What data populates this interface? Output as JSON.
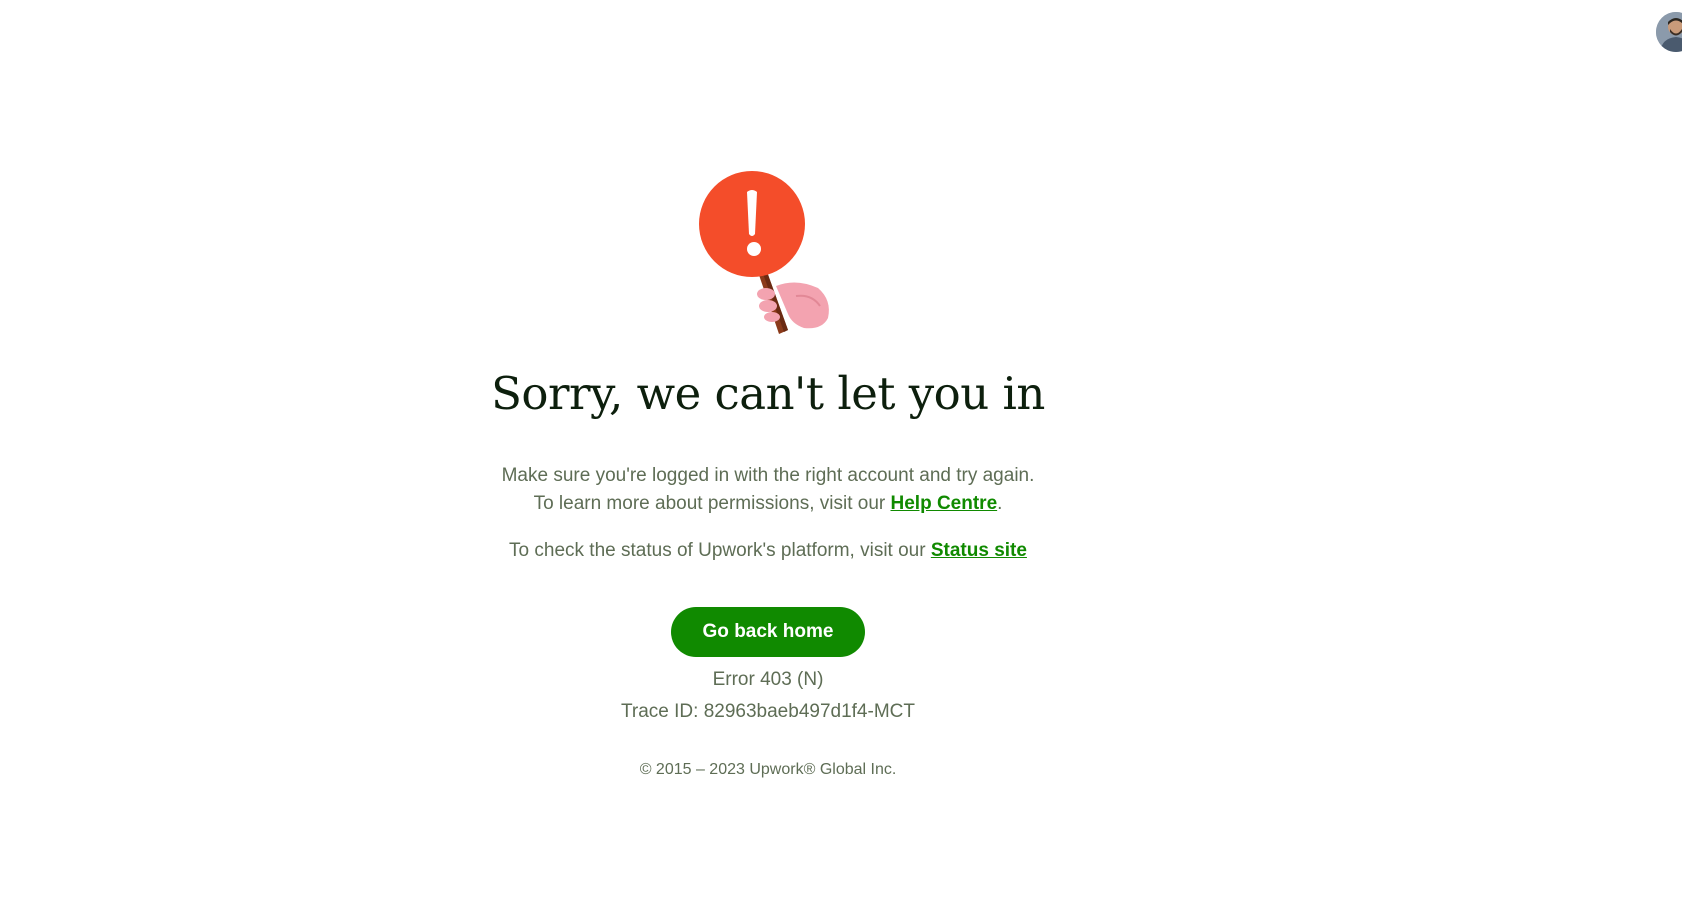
{
  "header": {
    "avatar_icon": "user-avatar-icon"
  },
  "illustration": {
    "icon": "stop-sign-hand-icon",
    "sign_color": "#f44d2a",
    "handle_color": "#8b3a1a",
    "hand_color": "#f3a3b0"
  },
  "main": {
    "title": "Sorry, we can't let you in",
    "message_line1": "Make sure you're logged in with the right account and try again.",
    "message_line2_prefix": "To learn more about permissions, visit our ",
    "help_link_label": "Help Centre",
    "message_line2_suffix": ".",
    "status_prefix": "To check the status of Upwork's platform, visit our ",
    "status_link_label": "Status site",
    "home_button_label": "Go back home",
    "error_code": "Error 403 (N)",
    "trace_id": "Trace ID: 82963baeb497d1f4-MCT"
  },
  "footer": {
    "copyright": "© 2015 – 2023 Upwork® Global Inc."
  },
  "colors": {
    "brand_green": "#108a00",
    "link_green": "#14a800",
    "text_gray": "#5e6d55",
    "title": "#0d1f0d"
  }
}
